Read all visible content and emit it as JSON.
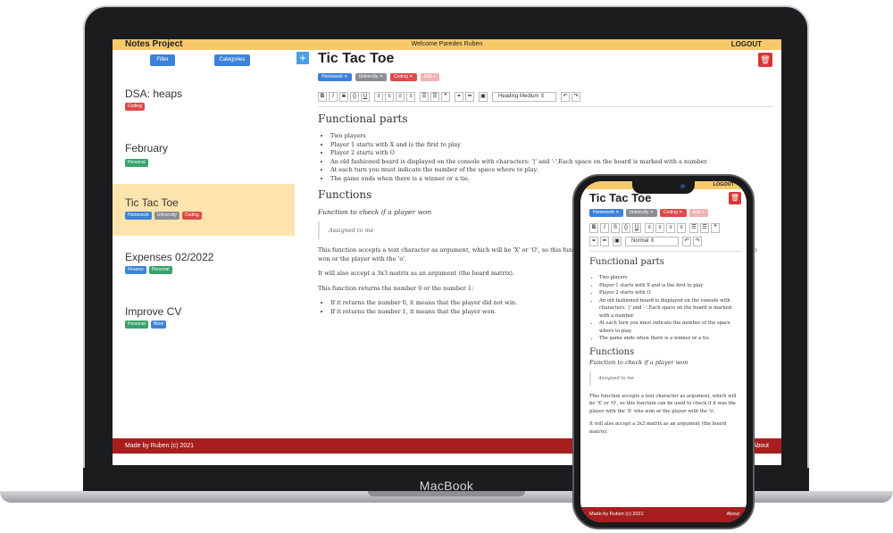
{
  "device": {
    "laptop_brand": "MacBook"
  },
  "header": {
    "app_title": "Notes Project",
    "welcome": "Welcome Paredes Ruben",
    "logout": "LOGOUT"
  },
  "sidebar": {
    "filter_label": "Filter",
    "categories_label": "Categories",
    "add_label": "+",
    "notes": [
      {
        "title": "DSA: heaps",
        "tags": [
          "Coding"
        ]
      },
      {
        "title": "February",
        "tags": [
          "Personal"
        ]
      },
      {
        "title": "Tic Tac Toe",
        "tags": [
          "Homework",
          "University",
          "Coding"
        ],
        "selected": true
      },
      {
        "title": "Expenses 02/2022",
        "tags": [
          "Finance",
          "Personal"
        ]
      },
      {
        "title": "Improve CV",
        "tags": [
          "Personal",
          "Work"
        ]
      }
    ]
  },
  "editor": {
    "title": "Tic Tac Toe",
    "tags": [
      {
        "label": "Homework",
        "color": "#3c82d8"
      },
      {
        "label": "University",
        "color": "#8a8d93"
      },
      {
        "label": "Coding",
        "color": "#dd4a4a"
      },
      {
        "label": "Add",
        "color": "#f4b2b2"
      }
    ],
    "toolbar": {
      "buttons": [
        "B",
        "I",
        "S",
        "{}",
        "U",
        "≡",
        "≡",
        "≡",
        "≡",
        "☰",
        "☰",
        "❞",
        "⚭",
        "⚮",
        "▣"
      ],
      "heading_select": "Heading Medium",
      "undo": "↶",
      "redo": "↷"
    },
    "doc": {
      "h1": "Functional parts",
      "bullets": [
        "Two players",
        "Player 1 starts with X and is the first to play",
        "Player 2 starts with O",
        "An old fashioned board is displayed on the console with characters: '|' and '-'.Each space on the board is marked with a number.",
        "At each turn you must indicate the number of the space where to play.",
        "The game ends when there is a winner or a tie."
      ],
      "h2": "Functions",
      "subtitle": "Function to check if a player won",
      "quote": "Assigned to me",
      "p1": "This function accepts a text character as argument, which will be 'X' or 'O', so this function can be used to check if it was the player with the 'X' who won or the player with the 'o'.",
      "p2": "It will also accept a 3x3 matrix as an argument (the board matrix).",
      "p3": "This function returns the number 0 or the number 1:",
      "bullets2": [
        "If it returns the number 0, it means that the player did not win.",
        "If it returns the number 1, it means that the player won."
      ]
    }
  },
  "footer": {
    "credit": "Made by Ruben (c) 2021",
    "about": "About"
  },
  "phone": {
    "logout": "LOGOUT",
    "heading_select": "Normal"
  }
}
